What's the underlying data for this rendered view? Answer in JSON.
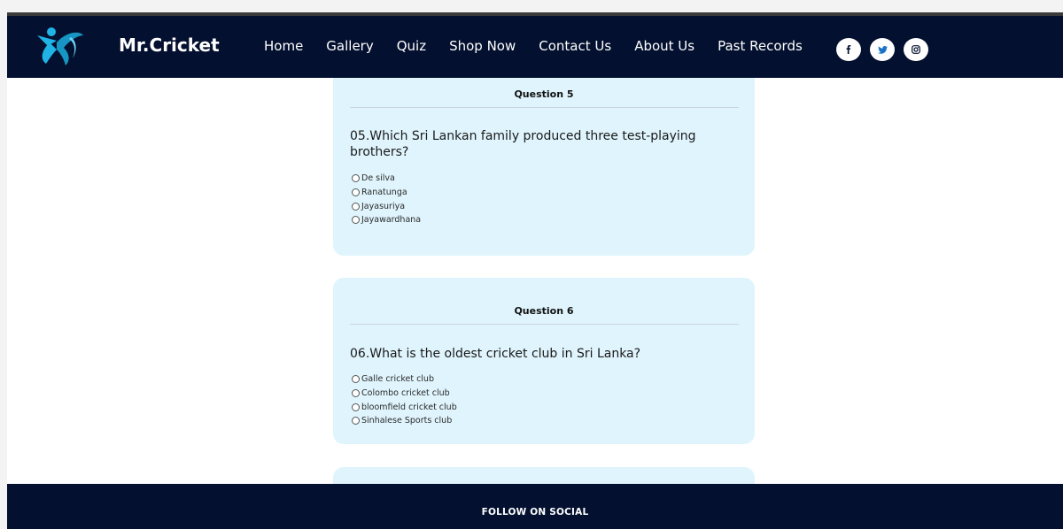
{
  "header": {
    "brand": "Mr.Cricket",
    "nav": [
      "Home",
      "Gallery",
      "Quiz",
      "Shop Now",
      "Contact Us",
      "About Us",
      "Past Records"
    ],
    "social_icons": [
      "facebook-icon",
      "twitter-icon",
      "instagram-icon"
    ]
  },
  "questions": [
    {
      "title": "Question 5",
      "text": "05.Which Sri Lankan family produced three test-playing brothers?",
      "options": [
        "De silva",
        "Ranatunga",
        "Jayasuriya",
        "Jayawardhana"
      ]
    },
    {
      "title": "Question 6",
      "text": "06.What is the oldest cricket club in Sri Lanka?",
      "options": [
        "Galle cricket club",
        "Colombo cricket club",
        "bloomfield cricket club",
        "Sinhalese Sports club"
      ]
    }
  ],
  "footer": {
    "title": "FOLLOW ON SOCIAL"
  },
  "colors": {
    "navbar": "#03102f",
    "card": "#dff4fc",
    "logo_accent": "#1fb3e6"
  }
}
